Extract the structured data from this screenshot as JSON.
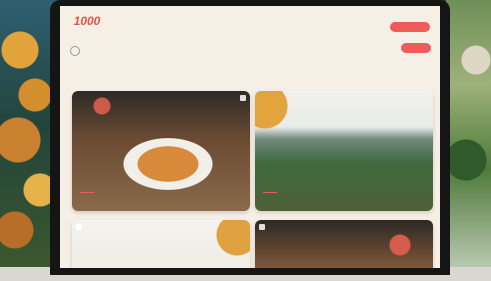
{
  "header": {
    "logo_number": "1000",
    "logo_subtitle": "",
    "menu": [
      "",
      "",
      "",
      "",
      ""
    ],
    "cta_primary": "",
    "cta_secondary": ""
  },
  "main": {
    "tagline": ""
  },
  "cards": [
    {
      "title": "",
      "image": "food-plate-photo"
    },
    {
      "title": "",
      "image": "valley-landscape-photo"
    },
    {
      "title": "",
      "image": "autumn-leaves-photo"
    },
    {
      "title": "",
      "image": "restaurant-table-photo"
    }
  ],
  "colors": {
    "accent": "#ee5c5a",
    "logo": "#e0584a",
    "page_background": "#f6efe6"
  }
}
